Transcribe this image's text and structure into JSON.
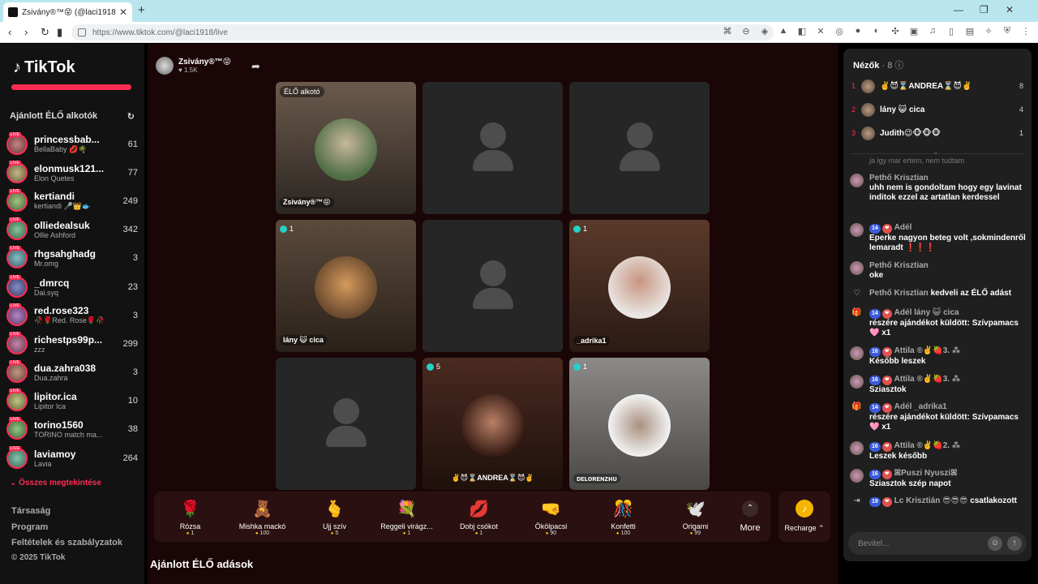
{
  "browser": {
    "tab_title": "Zsivány®™😝 (@laci1918) É...",
    "url": "https://www.tiktok.com/@laci1918/live"
  },
  "sidebar": {
    "logo": "TikTok",
    "section_title": "Ajánlott ÉLŐ alkotók",
    "creators": [
      {
        "name": "princessbab...",
        "sub": "BellaBaby 💋🌴",
        "count": "61"
      },
      {
        "name": "elonmusk121...",
        "sub": "Elon Quetes",
        "count": "77"
      },
      {
        "name": "kertiandi",
        "sub": "kertiandi 🎤👑🐟",
        "count": "249"
      },
      {
        "name": "olliedealsuk",
        "sub": "Ollie Ashford",
        "count": "342"
      },
      {
        "name": "rhgsahghadg",
        "sub": "Mr.omg",
        "count": "3"
      },
      {
        "name": "_dmrcq",
        "sub": "Dai.syq",
        "count": "23"
      },
      {
        "name": "red.rose323",
        "sub": "🥀🌹Red. Rose🌹🥀",
        "count": "3"
      },
      {
        "name": "richestps99p...",
        "sub": "zzz",
        "count": "299"
      },
      {
        "name": "dua.zahra038",
        "sub": "Dua.zahra",
        "count": "3"
      },
      {
        "name": "lipitor.ica",
        "sub": "Lipitor Ica",
        "count": "10"
      },
      {
        "name": "torino1560",
        "sub": "TORINO match ma...",
        "count": "38"
      },
      {
        "name": "laviamoy",
        "sub": "Lavia",
        "count": "264"
      }
    ],
    "see_all": "Összes megtekintése",
    "footer": [
      "Társaság",
      "Program",
      "Feltételek és szabályzatok",
      "© 2025 TikTok"
    ]
  },
  "host": {
    "name": "Zsivány®™😝",
    "likes": "♥ 1.5K"
  },
  "grid": {
    "creator_tag": "ÉLŐ alkotó",
    "cells": [
      {
        "label": "Zsivány®™😝",
        "guest": ""
      },
      {
        "label": "",
        "guest": ""
      },
      {
        "label": "",
        "guest": ""
      },
      {
        "label": "lány 😺 cica",
        "guest": "1"
      },
      {
        "label": "",
        "guest": ""
      },
      {
        "label": "_adrika1",
        "guest": "1"
      },
      {
        "label": "",
        "guest": ""
      },
      {
        "label": "✌️😈⌛ANDREA⌛😈✌️",
        "guest": "5"
      },
      {
        "label": "ᴅᴇʟᴏʀᴇɴᴢʜᴜ",
        "guest": "1"
      }
    ]
  },
  "gifts": [
    {
      "icon": "🌹",
      "name": "Rózsa",
      "price": "1"
    },
    {
      "icon": "🧸",
      "name": "Mishka mackó",
      "price": "100"
    },
    {
      "icon": "🫰",
      "name": "Ujj szív",
      "price": "5"
    },
    {
      "icon": "💐",
      "name": "Reggeli virágz...",
      "price": "1"
    },
    {
      "icon": "💋",
      "name": "Dobj csókot",
      "price": "1"
    },
    {
      "icon": "🤜",
      "name": "Ökölpacsi",
      "price": "90"
    },
    {
      "icon": "🎊",
      "name": "Konfetti",
      "price": "100"
    },
    {
      "icon": "🕊️",
      "name": "Origami",
      "price": "99"
    }
  ],
  "more_label": "More",
  "recharge_label": "Recharge ⌃",
  "recommended_title": "Ajánlott ÉLŐ adások",
  "chat": {
    "viewers_title": "Nézők",
    "viewers_count": "· 8 ⓘ",
    "top_viewers": [
      {
        "rank": "1",
        "name": "✌️😈⌛ANDREA⌛😈✌️",
        "score": "8"
      },
      {
        "rank": "2",
        "name": "lány 😺 cica",
        "score": "4"
      },
      {
        "rank": "3",
        "name": "Judith😉🐵🐵🐵",
        "score": "1"
      }
    ],
    "messages": [
      {
        "type": "faded",
        "text": "ja igy mar ertem, nem tudtam"
      },
      {
        "type": "user",
        "who": "Pethő Krisztian",
        "text": "uhh nem is gondoltam hogy egy lavinat inditok ezzel az artatlan kerdessel"
      },
      {
        "type": "user",
        "badge": "14",
        "who": "Adél",
        "text": "Eperke nagyon beteg volt ,sokmindenről lemaradt ❗❗❗"
      },
      {
        "type": "user",
        "who": "Pethő Krisztian",
        "text": "oke"
      },
      {
        "type": "event",
        "icon": "♡",
        "who": "Pethő Krisztian",
        "text": "kedveli az ÉLŐ adást"
      },
      {
        "type": "gift",
        "icon": "🎁",
        "badge": "14",
        "who": "Adél lány 😺 cica",
        "text": "részére ajándékot küldött: Szívpamacs 🩷 x1"
      },
      {
        "type": "user",
        "badge": "16",
        "who": "Attila ®✌️🍓3. ⁂",
        "text": "Később leszek"
      },
      {
        "type": "user",
        "badge": "16",
        "who": "Attila ®✌️🍓3. ⁂",
        "text": "Sziasztok"
      },
      {
        "type": "gift",
        "icon": "🎁",
        "badge": "14",
        "who": "Adél _adrika1",
        "text": "részére ajándékot küldött: Szívpamacs 🩷 x1"
      },
      {
        "type": "user",
        "badge": "16",
        "who": "Attila ®✌️🍓2. ⁂",
        "text": "Leszek később"
      },
      {
        "type": "user",
        "badge": "16",
        "who": "ꕤPuszi Nyusziꕤ",
        "text": "Sziasztok szép napot"
      },
      {
        "type": "event",
        "icon": "⇥",
        "badge": "19",
        "who": "Lc Krisztián 😎😎😎",
        "text": "csatlakozott"
      }
    ],
    "input_placeholder": "Bevitel..."
  }
}
